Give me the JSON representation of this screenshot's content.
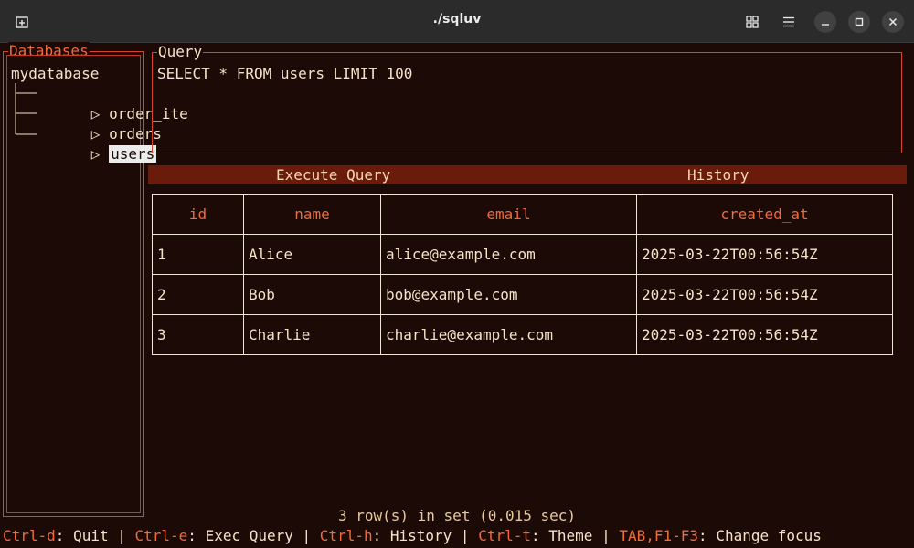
{
  "window": {
    "title": "./sqluv"
  },
  "sidebar": {
    "title": "Databases",
    "database": "mydatabase",
    "tables": [
      {
        "label": "order_ite",
        "selected": false
      },
      {
        "label": "orders",
        "selected": false
      },
      {
        "label": "users",
        "selected": true
      }
    ],
    "expander_glyph": "▷"
  },
  "query": {
    "title": "Query",
    "text": "SELECT * FROM users LIMIT 100"
  },
  "buttons": {
    "execute": "Execute Query",
    "history": "History"
  },
  "results": {
    "columns": [
      "id",
      "name",
      "email",
      "created_at"
    ],
    "rows": [
      [
        "1",
        "Alice",
        "alice@example.com",
        "2025-03-22T00:56:54Z"
      ],
      [
        "2",
        "Bob",
        "bob@example.com",
        "2025-03-22T00:56:54Z"
      ],
      [
        "3",
        "Charlie",
        "charlie@example.com",
        "2025-03-22T00:56:54Z"
      ]
    ]
  },
  "status": "3 row(s) in set (0.015 sec)",
  "help": [
    {
      "key": "Ctrl-d",
      "desc": "Quit"
    },
    {
      "key": "Ctrl-e",
      "desc": "Exec Query"
    },
    {
      "key": "Ctrl-h",
      "desc": "History"
    },
    {
      "key": "Ctrl-t",
      "desc": "Theme"
    },
    {
      "key": "TAB,F1-F3",
      "desc": "Change focus"
    }
  ],
  "colors": {
    "accent": "#f06a3a",
    "border": "#d7462c",
    "background": "#1b0a05",
    "button_bar": "#6b1b0b",
    "text": "#f5e3c8"
  },
  "icons": {
    "new_tab": "new-tab-icon",
    "grid": "grid-view-icon",
    "menu": "hamburger-menu-icon",
    "minimize": "minimize-icon",
    "maximize": "maximize-icon",
    "close": "close-icon"
  }
}
